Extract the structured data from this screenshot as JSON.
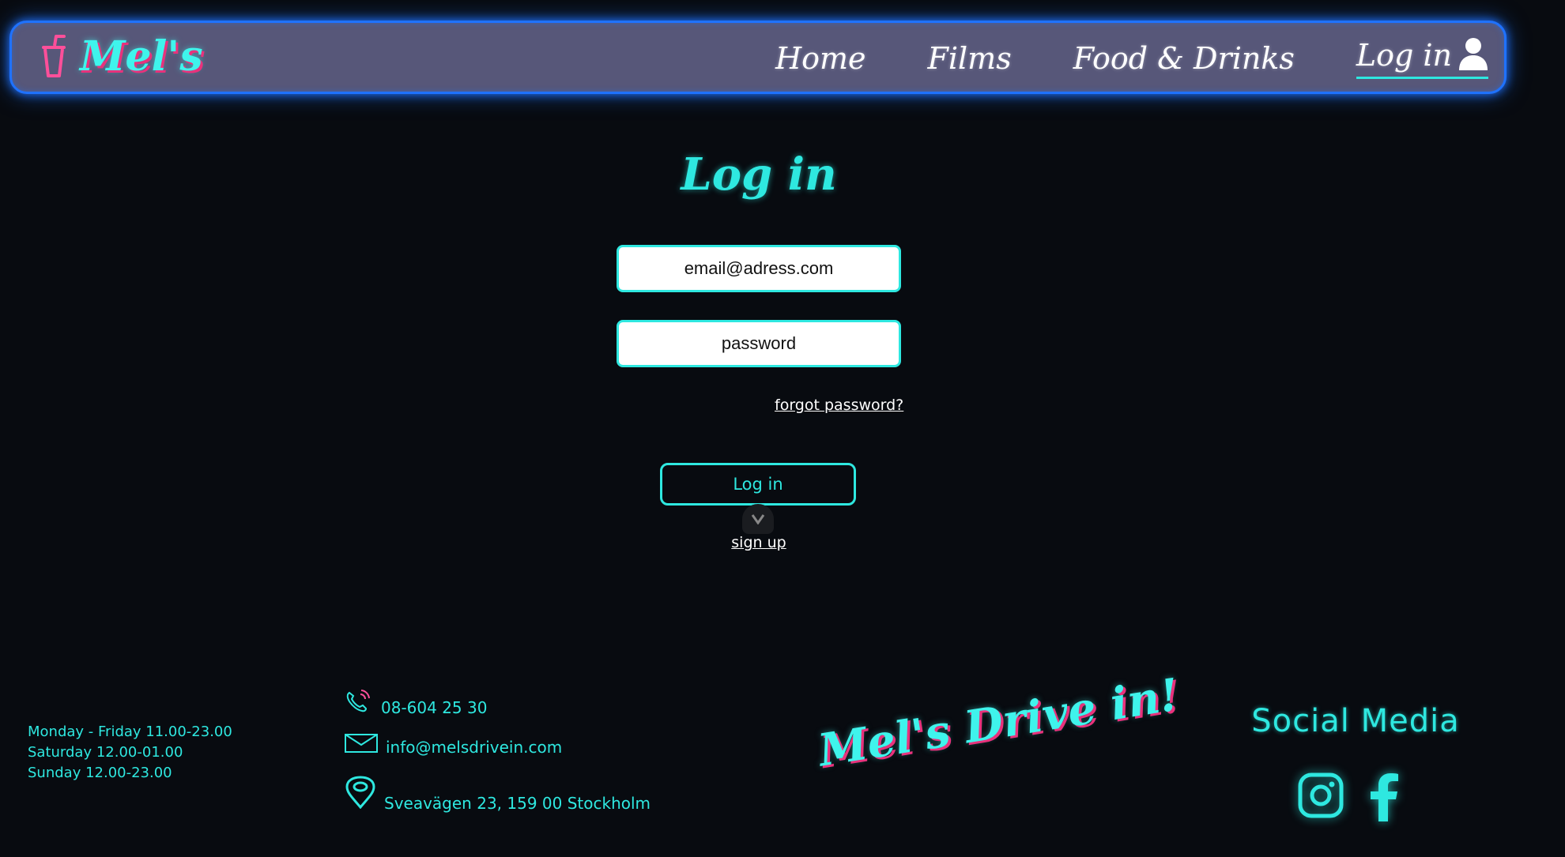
{
  "nav": {
    "brand": "Mel's",
    "links": [
      "Home",
      "Films",
      "Food & Drinks"
    ],
    "login_label": "Log in"
  },
  "main": {
    "title": "Log in",
    "email_placeholder": "email@adress.com",
    "password_placeholder": "password",
    "forgot_label": "forgot password?",
    "login_button": "Log in",
    "signup_label": "sign up"
  },
  "footer": {
    "hours": [
      "Monday - Friday 11.00-23.00",
      "Saturday 12.00-01.00",
      "Sunday 12.00-23.00"
    ],
    "phone": "08-604 25 30",
    "email": "info@melsdrivein.com",
    "address": "Sveavägen 23, 159 00 Stockholm",
    "tagline": "Mel's Drive in!",
    "social_title": "Social Media",
    "social_icons": [
      "instagram-icon",
      "facebook-icon"
    ]
  },
  "colors": {
    "accent": "#2ee8e0",
    "pink": "#e8327c",
    "nav_bg": "#575779",
    "nav_border": "#1f72ff",
    "page_bg": "#080b10"
  }
}
